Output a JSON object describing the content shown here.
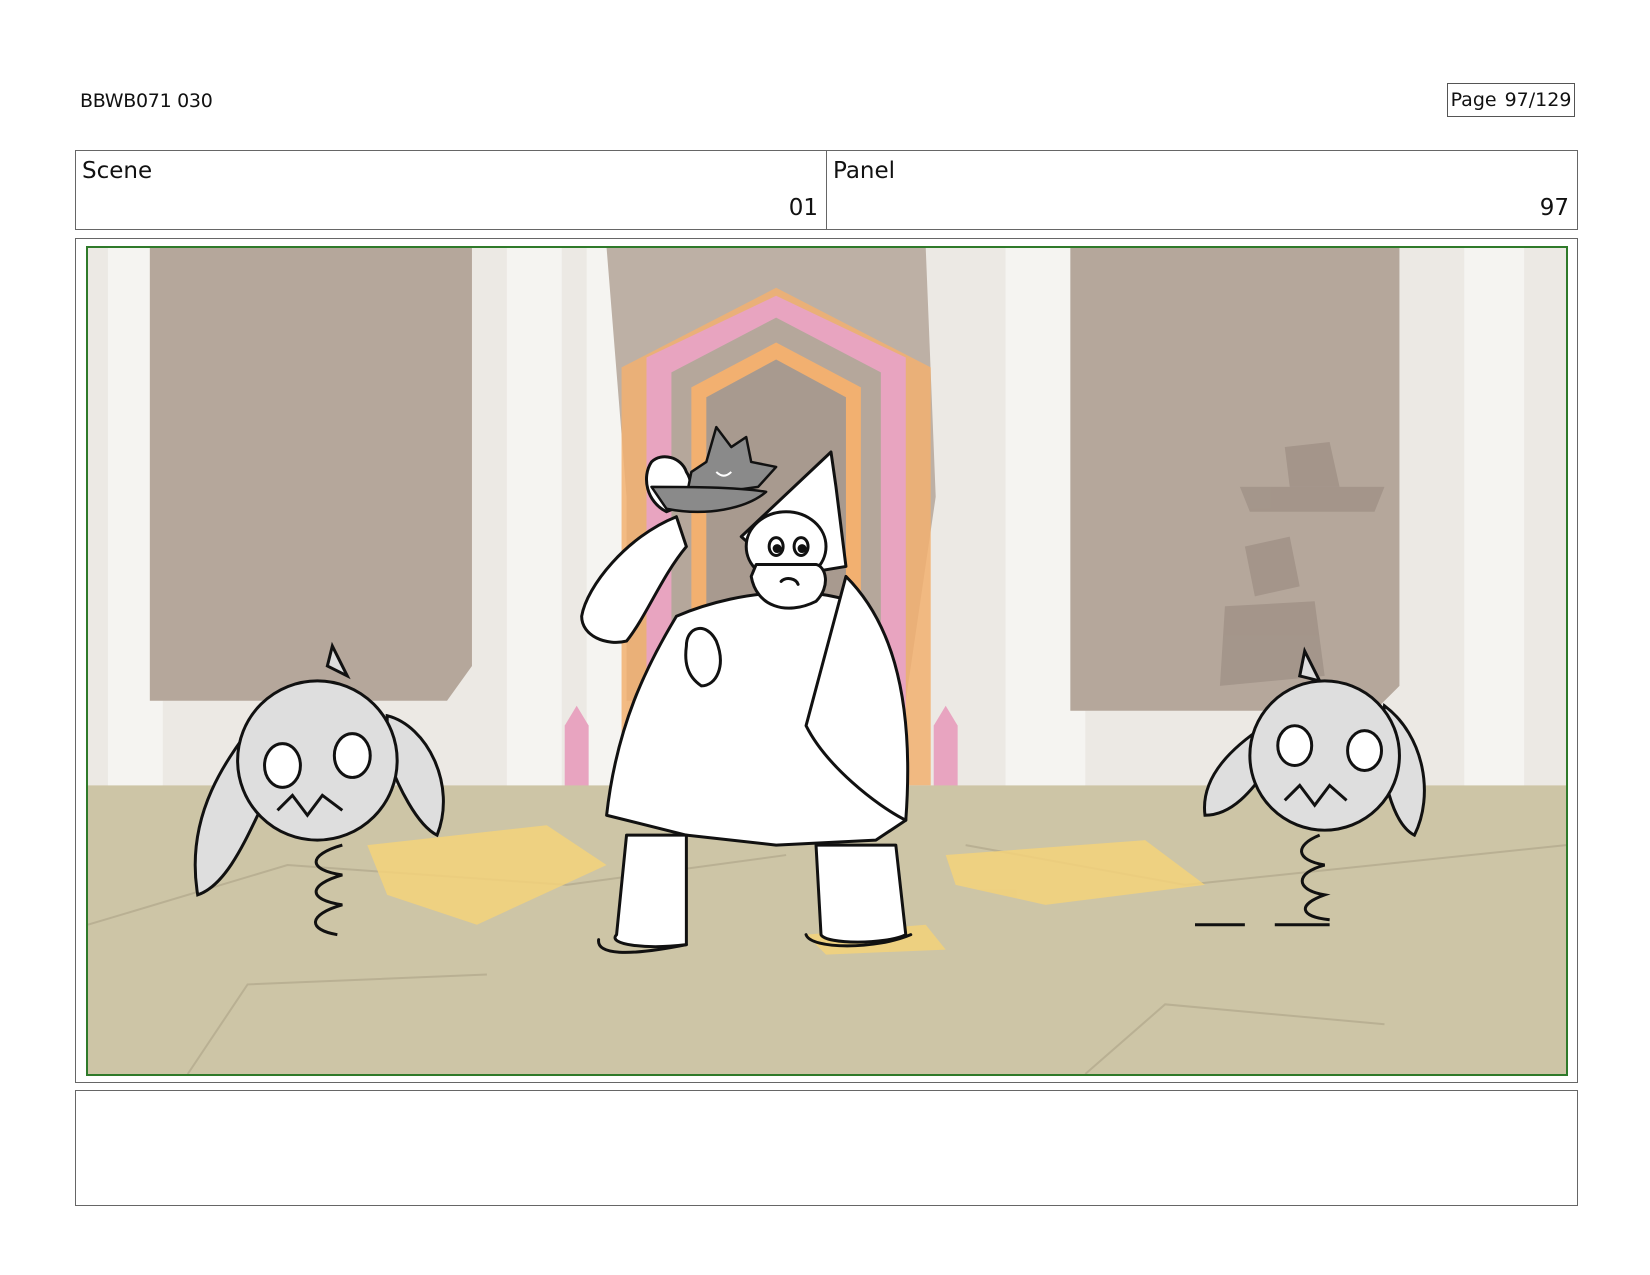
{
  "header": {
    "doc_id": "BBWB071 030",
    "page_label": "Page",
    "page_value": "97/129"
  },
  "scene": {
    "label": "Scene",
    "value": "01"
  },
  "panel": {
    "label": "Panel",
    "value": "97"
  },
  "colors": {
    "frame_border": "#2f7a2a",
    "floor": "#cdc5a6",
    "wall": "#ece9e4",
    "drape": "#b5a79b",
    "puddle": "#f3d27a",
    "door_pink": "#e8a4c0",
    "door_orange": "#f2b070"
  },
  "artwork": {
    "characters": [
      "wizard-character",
      "cat-character",
      "skull-spring-creature-left",
      "skull-spring-creature-right"
    ]
  },
  "notes": ""
}
